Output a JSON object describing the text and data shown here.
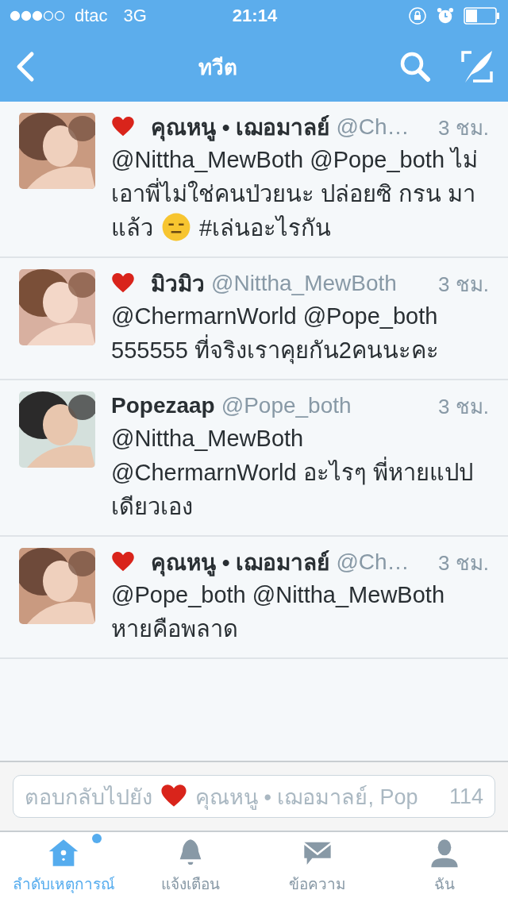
{
  "status_bar": {
    "carrier": "dtac",
    "network": "3G",
    "time": "21:14"
  },
  "nav": {
    "title": "ทวีต"
  },
  "tweets": [
    {
      "heart": true,
      "name": "คุณหนู • เฌอมาลย์",
      "handle": "@Ch…",
      "time": "3 ชม.",
      "body": [
        {
          "kind": "text",
          "text": "@Nittha_MewBoth @Pope_both ไม่เอาพี่ไม่ใช่คนป่วยนะ ปล่อยซิ กรน มาแล้ว "
        },
        {
          "kind": "emoji"
        },
        {
          "kind": "text",
          "text": " #เล่นอะไรกัน"
        }
      ]
    },
    {
      "heart": true,
      "name": "มิวมิว",
      "handle": "@Nittha_MewBoth",
      "time": "3 ชม.",
      "body": [
        {
          "kind": "text",
          "text": "@ChermarnWorld @Pope_both 555555 ที่จริงเราคุยกัน2คนนะคะ"
        }
      ]
    },
    {
      "heart": false,
      "name": "Popezaap",
      "handle": "@Pope_both",
      "time": "3 ชม.",
      "body": [
        {
          "kind": "text",
          "text": "@Nittha_MewBoth @ChermarnWorld อะไรๆ พี่หายแปปเดียวเอง"
        }
      ]
    },
    {
      "heart": true,
      "name": "คุณหนู • เฌอมาลย์",
      "handle": "@Ch…",
      "time": "3 ชม.",
      "body": [
        {
          "kind": "text",
          "text": "@Pope_both @Nittha_MewBoth หายคือพลาด"
        }
      ]
    }
  ],
  "reply": {
    "prefix": "ตอบกลับไปยัง",
    "heart": true,
    "recipients": "คุณหนู • เฌอมาลย์, Pop",
    "counter": "114"
  },
  "tabs": [
    {
      "kind": "home",
      "label": "ลำดับเหตุการณ์",
      "selected": true,
      "unread": true
    },
    {
      "kind": "bell",
      "label": "แจ้งเตือน",
      "selected": false,
      "unread": false
    },
    {
      "kind": "mail",
      "label": "ข้อความ",
      "selected": false,
      "unread": false
    },
    {
      "kind": "person",
      "label": "ฉัน",
      "selected": false,
      "unread": false
    }
  ]
}
